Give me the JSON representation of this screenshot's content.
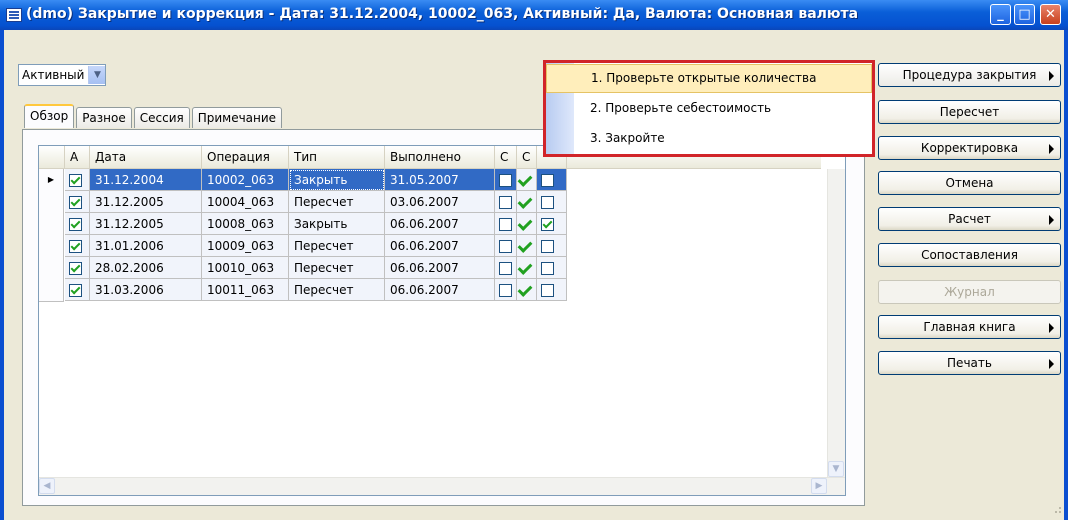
{
  "window": {
    "title": "(dmo) Закрытие и коррекция - Дата: 31.12.2004, 10002_063, Активный: Да, Валюта: Основная валюта",
    "minimize_glyph": "_",
    "maximize_glyph": "□",
    "close_glyph": "✕"
  },
  "filter": {
    "value": "Активный"
  },
  "tabs": [
    {
      "label": "Обзор"
    },
    {
      "label": "Разное"
    },
    {
      "label": "Сессия"
    },
    {
      "label": "Примечание"
    }
  ],
  "grid": {
    "headers": {
      "active": "А",
      "date": "Дата",
      "operation": "Операция",
      "type": "Тип",
      "executed": "Выполнено",
      "c": "С",
      "o": "С"
    },
    "rows": [
      {
        "active": true,
        "date": "31.12.2004",
        "operation": "10002_063",
        "type": "Закрыть",
        "executed": "31.05.2007",
        "c": false,
        "ok": true,
        "last": false
      },
      {
        "active": true,
        "date": "31.12.2005",
        "operation": "10004_063",
        "type": "Пересчет",
        "executed": "03.06.2007",
        "c": false,
        "ok": true,
        "last": false
      },
      {
        "active": true,
        "date": "31.12.2005",
        "operation": "10008_063",
        "type": "Закрыть",
        "executed": "06.06.2007",
        "c": false,
        "ok": true,
        "last": true
      },
      {
        "active": true,
        "date": "31.01.2006",
        "operation": "10009_063",
        "type": "Пересчет",
        "executed": "06.06.2007",
        "c": false,
        "ok": true,
        "last": false
      },
      {
        "active": true,
        "date": "28.02.2006",
        "operation": "10010_063",
        "type": "Пересчет",
        "executed": "06.06.2007",
        "c": false,
        "ok": true,
        "last": false
      },
      {
        "active": true,
        "date": "31.03.2006",
        "operation": "10011_063",
        "type": "Пересчет",
        "executed": "06.06.2007",
        "c": false,
        "ok": true,
        "last": false
      }
    ]
  },
  "buttons": {
    "close_procedure": "Процедура закрытия",
    "recalc": "Пересчет",
    "adjustment": "Корректировка",
    "cancel": "Отмена",
    "calc": "Расчет",
    "matching": "Сопоставления",
    "journal": "Журнал",
    "general_ledger": "Главная книга",
    "print": "Печать"
  },
  "popup_menu": {
    "items": [
      {
        "label": "1. Проверьте открытые количества"
      },
      {
        "label": "2. Проверьте себестоимость"
      },
      {
        "label": "3. Закройте"
      }
    ]
  },
  "colors": {
    "title_bar": "#0a5fd8",
    "selection": "#316ac5",
    "menu_highlight": "#ffeebb",
    "popup_border": "#d12429"
  }
}
